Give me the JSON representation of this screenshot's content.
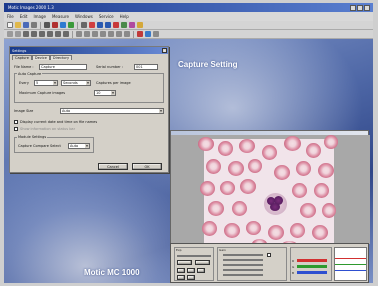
{
  "app": {
    "title": "Motic Images 2000 1.3",
    "menu": [
      "File",
      "Edit",
      "Image",
      "Measure",
      "Windows",
      "Service",
      "Help"
    ]
  },
  "dialog": {
    "title": "Settings",
    "tabs": [
      "Capture",
      "Device",
      "Directory"
    ],
    "file_name_label": "File Name :",
    "file_name_value": "Capture",
    "serial_label": "Serial number :",
    "serial_value": "001",
    "auto_capture_label": "Auto Capture",
    "every_label": "Every",
    "every_value": "5",
    "every_unit": "Seconds",
    "captures_label": "Captures per image",
    "max_label": "Maximum Capture images",
    "max_value": "10",
    "image_size_label": "Image Size",
    "image_size_value": "Auto",
    "check1_label": "Display current date and time on file names",
    "check2_label": "Show information on status bar",
    "module_label": "Module Settings",
    "module_sub_label": "Capture Compare Select",
    "module_value": "Auto",
    "cancel_label": "Cancel",
    "ok_label": "OK"
  },
  "headings": {
    "capture_setting": "Capture Setting",
    "brand": "Motic MC 1000"
  },
  "panel": {
    "exposure_label": "Exp",
    "gain_label": "Gain",
    "r_label": "R",
    "g_label": "G",
    "b_label": "B",
    "colors": [
      "#d23030",
      "#2e9a2e",
      "#2e4fd0"
    ]
  }
}
